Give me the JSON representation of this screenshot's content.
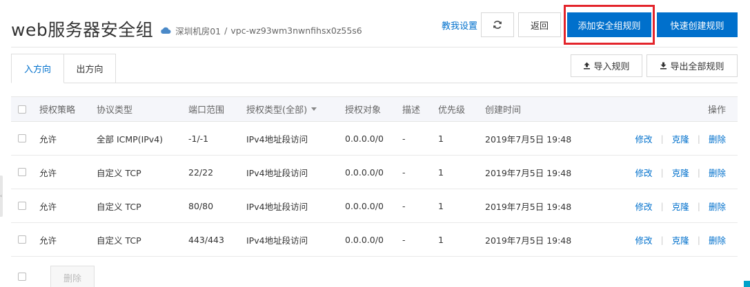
{
  "header": {
    "title": "web服务器安全组",
    "region": "深圳机房01",
    "separator": "/",
    "vpc_id": "vpc-wz93wm3nwnfihsx0z55s6"
  },
  "toolbar": {
    "tutorial_label": "教我设置",
    "back_label": "返回",
    "add_rule_label": "添加安全组规则",
    "quick_create_label": "快速创建规则",
    "import_label": "导入规则",
    "export_label": "导出全部规则"
  },
  "tabs": [
    {
      "label": "入方向",
      "active": true
    },
    {
      "label": "出方向",
      "active": false
    }
  ],
  "table": {
    "columns": {
      "policy": "授权策略",
      "protocol": "协议类型",
      "port": "端口范围",
      "auth_type": "授权类型(全部)",
      "target": "授权对象",
      "description": "描述",
      "priority": "优先级",
      "created": "创建时间",
      "actions": "操作"
    },
    "rows": [
      {
        "policy": "允许",
        "protocol": "全部 ICMP(IPv4)",
        "port": "-1/-1",
        "auth_type": "IPv4地址段访问",
        "target": "0.0.0.0/0",
        "description": "-",
        "priority": "1",
        "created": "2019年7月5日 19:48",
        "edit": "修改",
        "clone": "克隆",
        "delete": "删除"
      },
      {
        "policy": "允许",
        "protocol": "自定义 TCP",
        "port": "22/22",
        "auth_type": "IPv4地址段访问",
        "target": "0.0.0.0/0",
        "description": "-",
        "priority": "1",
        "created": "2019年7月5日 19:48",
        "edit": "修改",
        "clone": "克隆",
        "delete": "删除"
      },
      {
        "policy": "允许",
        "protocol": "自定义 TCP",
        "port": "80/80",
        "auth_type": "IPv4地址段访问",
        "target": "0.0.0.0/0",
        "description": "-",
        "priority": "1",
        "created": "2019年7月5日 19:48",
        "edit": "修改",
        "clone": "克隆",
        "delete": "删除"
      },
      {
        "policy": "允许",
        "protocol": "自定义 TCP",
        "port": "443/443",
        "auth_type": "IPv4地址段访问",
        "target": "0.0.0.0/0",
        "description": "-",
        "priority": "1",
        "created": "2019年7月5日 19:48",
        "edit": "修改",
        "clone": "克隆",
        "delete": "删除"
      }
    ]
  },
  "footer": {
    "batch_delete_label": "删除"
  },
  "colors": {
    "primary": "#0070cc",
    "highlight": "#e3242b"
  }
}
